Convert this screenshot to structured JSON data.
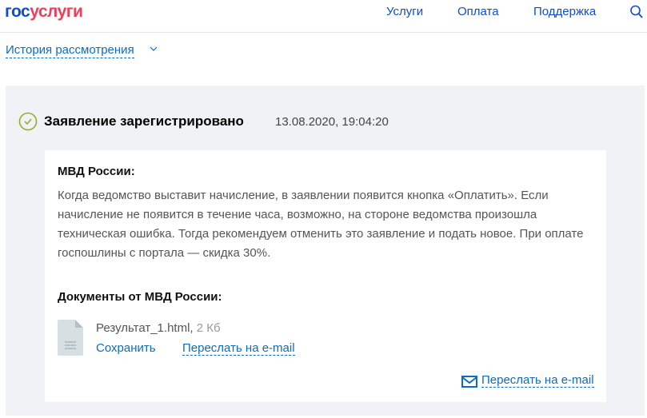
{
  "header": {
    "logo_part1": "гос",
    "logo_part2": "услуги",
    "nav": [
      "Услуги",
      "Оплата",
      "Поддержка"
    ]
  },
  "history": {
    "label": "История рассмотрения"
  },
  "event": {
    "status": "Заявление зарегистрировано",
    "date": "13.08.2020, 19:04:20",
    "org": "МВД России:",
    "message": "Когда ведомство выставит начисление, в заявлении появится кнопка «Оплатить». Если начисление не появится в течение часа, возможно, на стороне ведомства произошла техническая ошибка. Тогда рекомендуем отменить это заявление и подать новое. При оплате госпошлины с портала — скидка 30%.",
    "docs_title": "Документы от МВД России:",
    "file": {
      "name": "Результат_1.html,",
      "size": "2 Кб",
      "save": "Сохранить",
      "forward": "Переслать на e-mail"
    },
    "forward_all": "Переслать на e-mail"
  },
  "colors": {
    "brand_blue": "#0d4cd3",
    "brand_red": "#ee3f58",
    "link": "#0d6bc4",
    "success": "#8bb22a"
  }
}
